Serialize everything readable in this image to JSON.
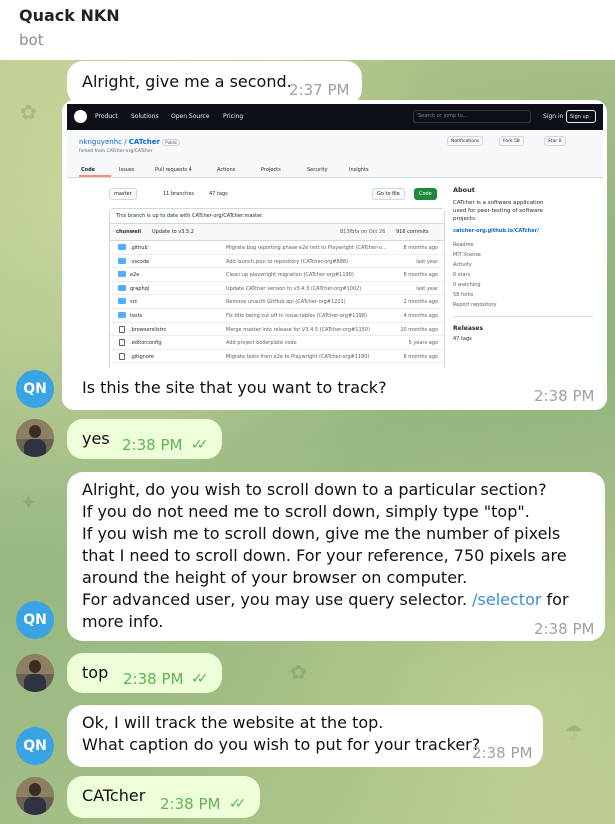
{
  "header": {
    "title": "Quack NKN",
    "subtitle": "bot"
  },
  "messages": {
    "m1": {
      "text": "Alright, give me a second.",
      "time": "2:37 PM"
    },
    "m2": {
      "text": "Is this the site that you want to track?",
      "time": "2:38 PM",
      "avatar": "QN"
    },
    "m3": {
      "text": "yes",
      "time": "2:38 PM"
    },
    "m4": {
      "line1": "Alright, do you wish to scroll down to a particular section?",
      "line2": "If you do not need me to scroll down, simply type \"top\".",
      "line3": "If you wish me to scroll down, give me the number of pixels that I need to scroll down. For your reference, 750 pixels are around the height of your browser on computer.",
      "line4_pre": "For advanced user, you may use query selector.",
      "line4_link": "/selector",
      "line4_post": "for more info.",
      "time": "2:38 PM",
      "avatar": "QN"
    },
    "m5": {
      "text": "top",
      "time": "2:38 PM"
    },
    "m6": {
      "line1": "Ok, I will track the website at the top.",
      "line2": "What caption do you wish to put for your tracker?",
      "time": "2:38 PM",
      "avatar": "QN"
    },
    "m7": {
      "text": "CATcher",
      "time": "2:38 PM"
    }
  },
  "screenshot": {
    "nav": [
      "Product",
      "Solutions",
      "Open Source",
      "Pricing"
    ],
    "search_placeholder": "Search or jump to...",
    "sign_in": "Sign in",
    "sign_up": "Sign up",
    "owner": "nkn­guyenhc",
    "repo": "CATcher",
    "visibility": "Public",
    "forked_from": "forked from CATcher-org/CATcher",
    "pills": [
      "Notifications",
      "Fork 58",
      "Star 0"
    ],
    "tabs": [
      "Code",
      "Issues",
      "Pull requests 4",
      "Actions",
      "Projects",
      "Security",
      "Insights"
    ],
    "branch": "master",
    "branches": "11 branches",
    "tags": "47 tags",
    "goto_file": "Go to file",
    "code_btn": "Code",
    "status_note": "This branch is up to date with CATcher-org/CATcher:master.",
    "commit_author": "chunweii",
    "commit_msg": "Update to v3.5.2",
    "commit_meta": "813fbfa on Oct 26",
    "commits": "916 commits",
    "files": [
      {
        "name": ".github",
        "msg": "Migrate bug reporting phase e2e test to Playwright (CATcher-o...",
        "age": "8 months ago",
        "type": "folder"
      },
      {
        "name": ".vscode",
        "msg": "Add launch.json to repository (CATcher-org#888)",
        "age": "last year",
        "type": "folder"
      },
      {
        "name": "e2e",
        "msg": "Clean up playwright migration (CATcher-org#1190)",
        "age": "8 months ago",
        "type": "folder"
      },
      {
        "name": "graphql",
        "msg": "Update CATcher version to v3.4.3 (CATcher-org#1002)",
        "age": "last year",
        "type": "folder"
      },
      {
        "name": "src",
        "msg": "Remove unauth GitHub api (CATcher-org#1221)",
        "age": "2 months ago",
        "type": "folder"
      },
      {
        "name": "tests",
        "msg": "Fix title being cut off in issue-tables (CATcher-org#1198)",
        "age": "4 months ago",
        "type": "folder"
      },
      {
        "name": ".browserslistrc",
        "msg": "Merge master into release for V3.4.5 (CATcher-org#1150)",
        "age": "10 months ago",
        "type": "file"
      },
      {
        "name": ".editorconfig",
        "msg": "Add project boilerplate code",
        "age": "5 years ago",
        "type": "file"
      },
      {
        "name": ".gitignore",
        "msg": "Migrate tests from e2e to Playwright (CATcher-org#1180)",
        "age": "8 months ago",
        "type": "file"
      }
    ],
    "about_title": "About",
    "about_desc": "CATcher is a software application used for peer-testing of software projects.",
    "about_link": "catcher-org.github.io/CATcher/",
    "about_items": [
      "Readme",
      "MIT license",
      "Activity",
      "0 stars",
      "0 watching",
      "58 forks",
      "Report repository"
    ],
    "releases_title": "Releases",
    "releases_tags": "47 tags"
  }
}
